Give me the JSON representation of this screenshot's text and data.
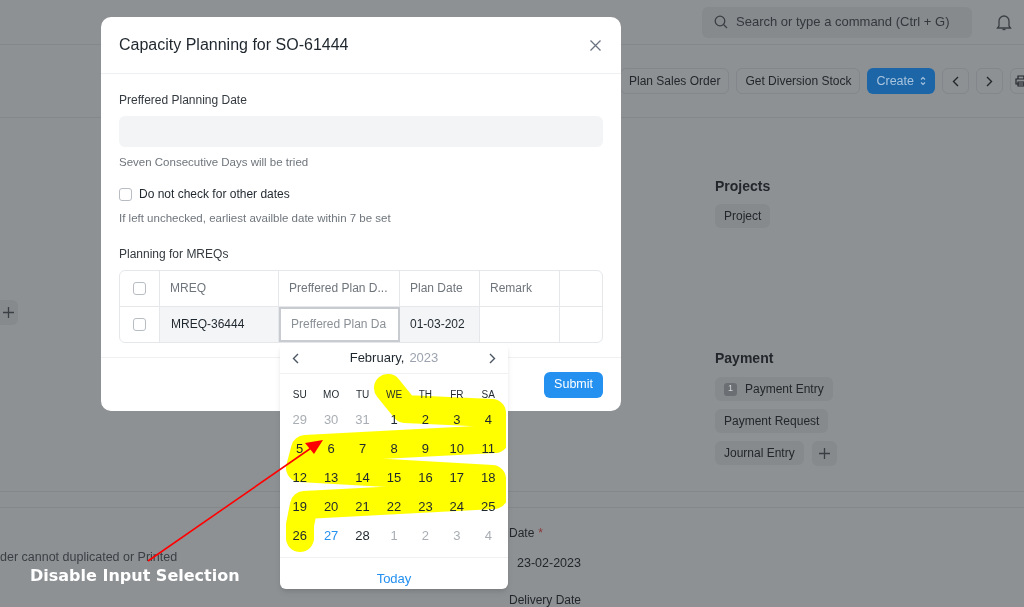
{
  "topbar": {
    "search_placeholder": "Search or type a command (Ctrl + G)"
  },
  "toolbar": {
    "buttons": [
      "Plan Sales Order",
      "Get Diversion Stock"
    ],
    "create": "Create"
  },
  "projects": {
    "heading": "Projects",
    "chips": [
      {
        "label": "Project"
      }
    ]
  },
  "payment": {
    "heading": "Payment",
    "chips": [
      {
        "label": "Payment Entry",
        "count": "1"
      },
      {
        "label": "Payment Request"
      },
      {
        "label": "Journal Entry"
      }
    ]
  },
  "lower": {
    "note": "der cannot duplicated or Printed",
    "date_label": "Date",
    "date_required_mark": "*",
    "date_value": "23-02-2023",
    "delivery_label": "Delivery Date"
  },
  "dialog": {
    "title": "Capacity Planning for SO-61444",
    "field_label": "Preffered Planning Date",
    "field_hint": "Seven Consecutive Days will be tried",
    "checkbox": {
      "label": "Do not check for other dates",
      "checked": false
    },
    "checkbox_hint": "If left unchecked, earliest availble date within 7 be set",
    "table_label": "Planning for MREQs",
    "all_checked": false,
    "columns": [
      "MREQ",
      "Preffered Plan D...",
      "Plan Date",
      "Remark"
    ],
    "rows": [
      {
        "checked": false,
        "mreq": "MREQ-36444",
        "preferred_placeholder": "Preffered Plan Da",
        "plan_date": "01-03-202"
      }
    ],
    "submit": "Submit"
  },
  "datepicker": {
    "month": "February,",
    "year": "2023",
    "weekdays": [
      "SU",
      "MO",
      "TU",
      "WE",
      "TH",
      "FR",
      "SA"
    ],
    "weeks": [
      {
        "days": [
          {
            "label": "29",
            "kind": "other"
          },
          {
            "label": "30",
            "kind": "other"
          },
          {
            "label": "31",
            "kind": "other"
          },
          {
            "label": "1",
            "kind": "day"
          },
          {
            "label": "2",
            "kind": "day"
          },
          {
            "label": "3",
            "kind": "day"
          },
          {
            "label": "4",
            "kind": "day"
          }
        ]
      },
      {
        "days": [
          {
            "label": "5",
            "kind": "day"
          },
          {
            "label": "6",
            "kind": "day"
          },
          {
            "label": "7",
            "kind": "day"
          },
          {
            "label": "8",
            "kind": "day"
          },
          {
            "label": "9",
            "kind": "day"
          },
          {
            "label": "10",
            "kind": "day"
          },
          {
            "label": "11",
            "kind": "day"
          }
        ]
      },
      {
        "days": [
          {
            "label": "12",
            "kind": "day"
          },
          {
            "label": "13",
            "kind": "day"
          },
          {
            "label": "14",
            "kind": "day"
          },
          {
            "label": "15",
            "kind": "day"
          },
          {
            "label": "16",
            "kind": "day"
          },
          {
            "label": "17",
            "kind": "day"
          },
          {
            "label": "18",
            "kind": "day"
          }
        ]
      },
      {
        "days": [
          {
            "label": "19",
            "kind": "day"
          },
          {
            "label": "20",
            "kind": "day"
          },
          {
            "label": "21",
            "kind": "day"
          },
          {
            "label": "22",
            "kind": "day"
          },
          {
            "label": "23",
            "kind": "day"
          },
          {
            "label": "24",
            "kind": "day"
          },
          {
            "label": "25",
            "kind": "day"
          }
        ]
      },
      {
        "days": [
          {
            "label": "26",
            "kind": "day"
          },
          {
            "label": "27",
            "kind": "today"
          },
          {
            "label": "28",
            "kind": "day"
          },
          {
            "label": "1",
            "kind": "other"
          },
          {
            "label": "2",
            "kind": "other"
          },
          {
            "label": "3",
            "kind": "other"
          },
          {
            "label": "4",
            "kind": "other"
          }
        ]
      }
    ],
    "today": "Today"
  },
  "annotation": {
    "label": "Disable Input Selection"
  }
}
